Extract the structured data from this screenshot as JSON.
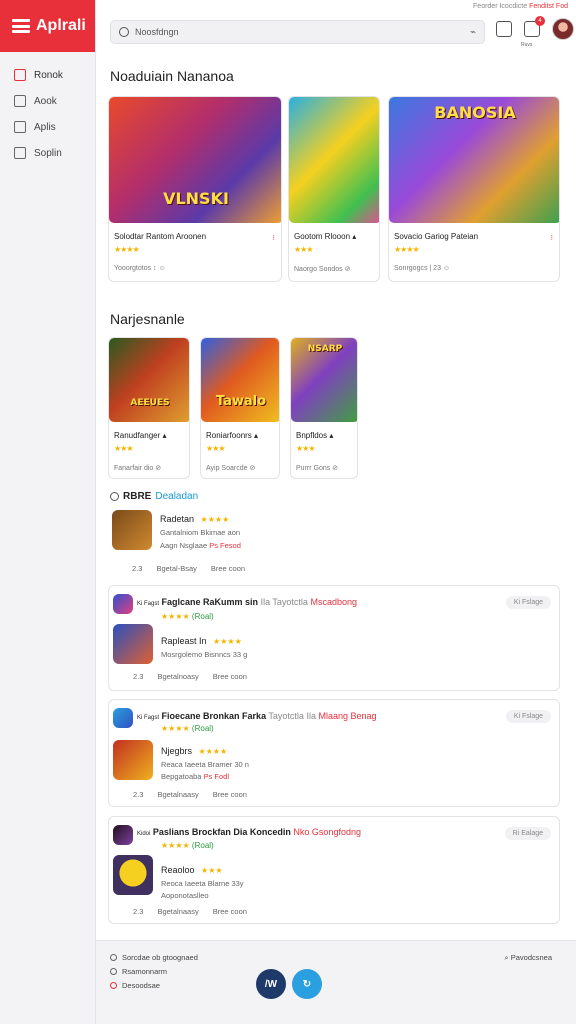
{
  "app": {
    "name": "Aplrali"
  },
  "sidebar": {
    "items": [
      {
        "label": "Ronok",
        "icon": "game-icon"
      },
      {
        "label": "Aook",
        "icon": "square-icon"
      },
      {
        "label": "Aplis",
        "icon": "apps-icon"
      },
      {
        "label": "Soplin",
        "icon": "list-icon"
      }
    ]
  },
  "header": {
    "search_placeholder": "Noosfdngn",
    "top_link": "Feorder Icocdicte",
    "top_link_accent": "Fenditst Fod",
    "notif_count": "4",
    "notif_sub": "Ruvs"
  },
  "section1": {
    "title": "Noaduiain Nananoa",
    "cards": [
      {
        "art_text": "VLNSKI",
        "title": "Solodtar Rantom Aroonen",
        "stars": "★★★★",
        "meta": "Yooorgtotos  ↕ ☺",
        "tag": "⁝"
      },
      {
        "art_text": "",
        "title": "Gootom Rlooon  ▴",
        "stars": "★★★",
        "meta": "Naorgo Sondos  ⊘",
        "tag": ""
      },
      {
        "art_text": "BANOSIA",
        "title": "Sovacio Gariog Pateian",
        "stars": "★★★★",
        "meta": "Sonrgogcs | 23  ☺",
        "tag": "⁝"
      }
    ]
  },
  "section2": {
    "title": "Narjesnanle",
    "cards": [
      {
        "art_text": "AEEUES",
        "title": "Ranudfanger  ▴",
        "stars": "★★★",
        "meta": "Fanarfair dio  ⊘"
      },
      {
        "art_text": "Tawalo",
        "title": "Roniarfoonrs  ▴",
        "stars": "★★★",
        "meta": "Ayip Soarcde  ⊘"
      },
      {
        "art_text": "NSARP",
        "title": "Bnpfldos  ▴",
        "stars": "★★★",
        "meta": "Purrr Gons  ⊘"
      }
    ]
  },
  "list": {
    "title": "RBRE",
    "title_accent": "Dealadan",
    "items": [
      {
        "name": "Radetan",
        "stars": "★★★★",
        "desc": "Gantalniom Bkimae aon",
        "sub": "Aagn Nsglaae",
        "sub_accent": "Ps Fesod",
        "foot1": "Bgetal-Bsay",
        "foot2": "Bree coon",
        "num": "2.3"
      },
      {
        "head": "Faglcane RaKumm sin",
        "head_grey": "Ila  Tayotctla",
        "head_red": "Mscadbong",
        "badge": "Ki Fagst",
        "pill": "Ki Fslage",
        "name": "Rapleast In",
        "stars": "★★★★",
        "desc": "Mosrgolemo Bisnncs 33 g",
        "foot1": "Bgetalnoasy",
        "foot2": "Bree coon",
        "num": "2.3"
      },
      {
        "head": "Fioecane Bronkan Farka",
        "head_grey": "Tayotctla  Ila",
        "head_red": "Mlaang Benag",
        "badge": "Ki Fagst",
        "pill": "Ki Fslage",
        "name": "Njegbrs",
        "stars": "★★★★",
        "desc": "Reaca Iaeeta Bramer 30 n",
        "sub": "Bepgatoaba",
        "sub_accent": "Ps Fodl",
        "foot1": "Bgetalnaasy",
        "foot2": "Bree coon",
        "num": "2.3"
      },
      {
        "head": "Paslians Brockfan Dia Koncedin",
        "head_red": "Nko Gsongfodng",
        "badge": "Kidoi",
        "pill": "Ri Ealage",
        "name": "Reaoloo",
        "stars": "★★★",
        "desc": "Reoca Iaeeta Blarne 33y",
        "sub": "Aoponotaslleo",
        "foot1": "Bgetalnaasy",
        "foot2": "Bree coon",
        "num": "2.3"
      }
    ]
  },
  "footer": {
    "links": [
      "Sorcdae ob gtoognaed",
      "Rsamonnarm",
      "Desoodsae"
    ],
    "right": "Pavodcsnea",
    "fab1": "/W",
    "fab2": "↻"
  },
  "colors": {
    "accent": "#e8303b",
    "link": "#1a9ad6",
    "star": "#f4b400"
  }
}
